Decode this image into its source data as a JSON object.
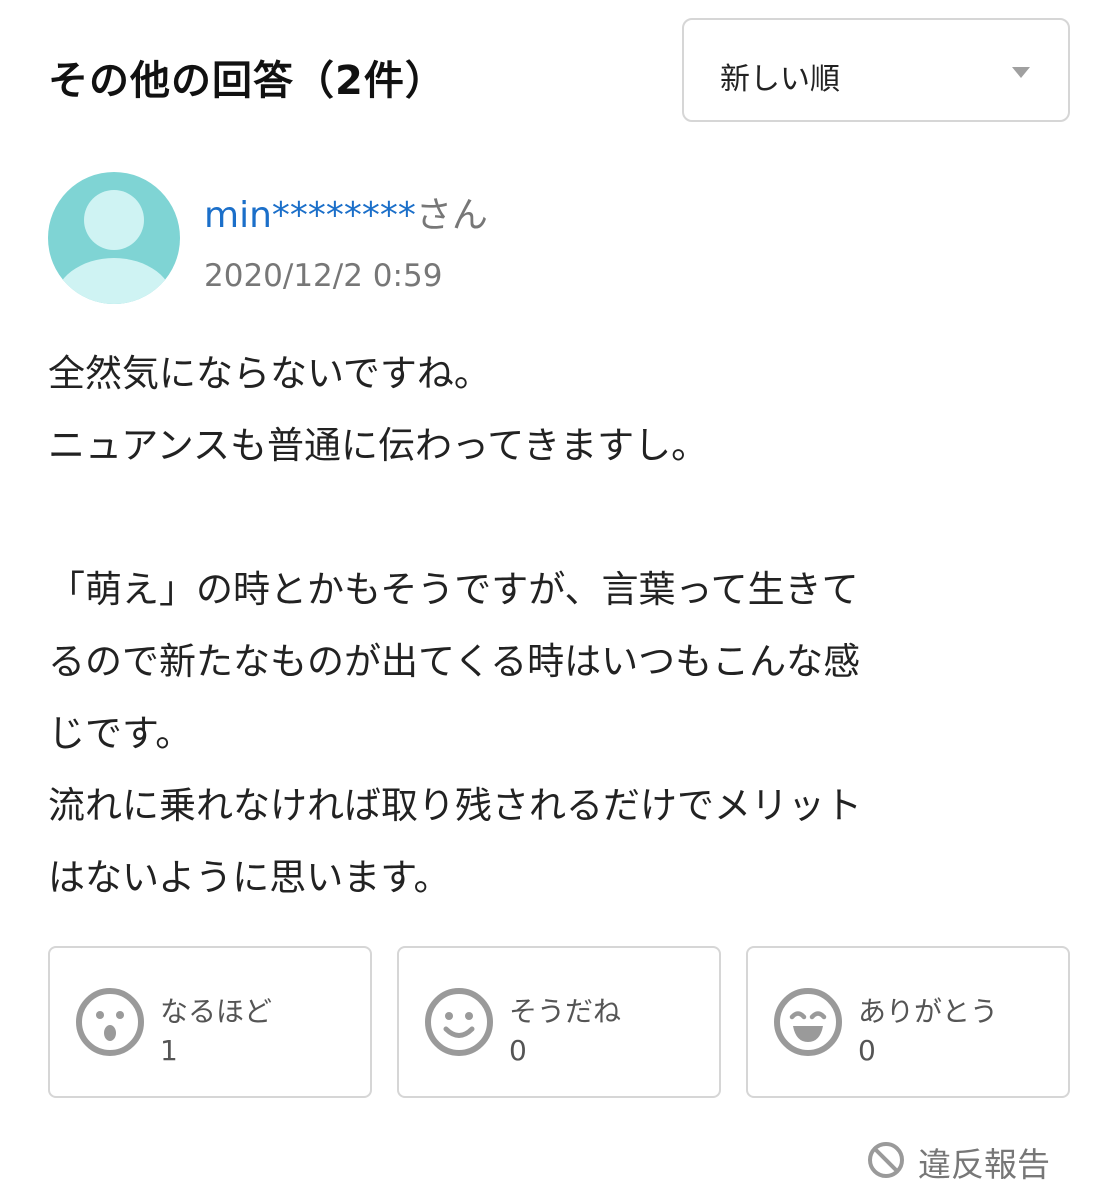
{
  "header": {
    "title": "その他の回答（2件）",
    "sort": {
      "selected": "新しい順"
    }
  },
  "answer": {
    "user_id": "min********",
    "user_suffix": "さん",
    "timestamp": "2020/12/2 0:59",
    "body_lines": [
      "全然気にならないですね。",
      "ニュアンスも普通に伝わってきますし。",
      "",
      "「萌え」の時とかもそうですが、言葉って生きて",
      "るので新たなものが出てくる時はいつもこんな感",
      "じです。",
      "流れに乗れなければ取り残されるだけでメリット",
      "はないように思います。"
    ],
    "reactions": [
      {
        "icon": "surprised-face-icon",
        "label": "なるほど",
        "count": "1"
      },
      {
        "icon": "smile-face-icon",
        "label": "そうだね",
        "count": "0"
      },
      {
        "icon": "grin-face-icon",
        "label": "ありがとう",
        "count": "0"
      }
    ],
    "report_label": "違反報告"
  },
  "colors": {
    "username": "#1b6fc9",
    "avatar_bg": "#7fd4d4",
    "avatar_fg": "#cff3f3",
    "muted_text": "#777777",
    "border": "#d6d6d6"
  }
}
